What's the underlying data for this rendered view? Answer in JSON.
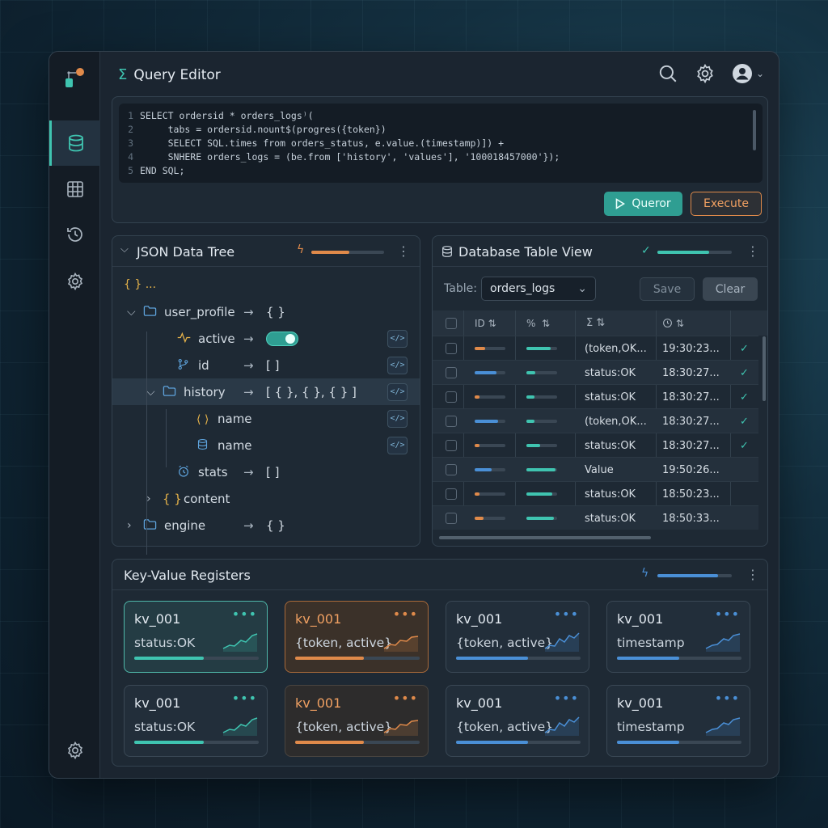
{
  "colors": {
    "accent_teal": "#3fc4b0",
    "accent_orange": "#e08a4a",
    "accent_blue": "#4a8fd6"
  },
  "sidebar": {
    "items": [
      {
        "icon": "database-icon",
        "active": true
      },
      {
        "icon": "table-grid-icon",
        "active": false
      },
      {
        "icon": "history-icon",
        "active": false
      },
      {
        "icon": "gear-icon",
        "active": false
      }
    ],
    "bottom_icon": "gear-icon"
  },
  "header": {
    "title": "Query Editor",
    "title_icon": "sigma-icon"
  },
  "editor": {
    "lines": [
      {
        "n": "1",
        "text": "SELECT ordersid * orders_logs⁾("
      },
      {
        "n": "2",
        "text": "     tabs = ordersid.nount$(progres({token})"
      },
      {
        "n": "3",
        "text": "     SELECT SQL.times from orders_status, e.value.(timestamp)]) +"
      },
      {
        "n": "4",
        "text": "     SNHERE orders_logs = (be.from ['history', 'values'], '100018457000'});"
      },
      {
        "n": "5",
        "text": "END SQL;"
      }
    ],
    "query_button": "Queror",
    "execute_button": "Execute"
  },
  "json_tree": {
    "title": "JSON Data Tree",
    "progress": 0.52,
    "root": "{ } ...",
    "rows": [
      {
        "label": "user_profile",
        "value": "{ }",
        "icon": "folder-icon"
      },
      {
        "label": "active",
        "value": "",
        "icon": "activity-icon",
        "toggle": true
      },
      {
        "label": "id",
        "value": "[ ]",
        "icon": "branch-icon"
      },
      {
        "label": "history",
        "value": "[ { }, { }, { } ]",
        "icon": "folder-icon"
      },
      {
        "label": "name",
        "value": "",
        "icon": "code-brackets-icon"
      },
      {
        "label": "name",
        "value": "",
        "icon": "database-icon"
      },
      {
        "label": "stats",
        "value": "[ ]",
        "icon": "clock-icon"
      },
      {
        "label": "content",
        "value": "",
        "icon": "braces-icon"
      },
      {
        "label": "engine",
        "value": "{ }",
        "icon": "folder-icon"
      }
    ],
    "arrow": "→",
    "chip": "</>"
  },
  "db_table": {
    "title": "Database Table View",
    "progress": 0.7,
    "table_label": "Table:",
    "table_selected": "orders_logs",
    "save_button": "Save",
    "clear_button": "Clear",
    "headers": [
      "ID",
      "%",
      "Σ",
      "clock"
    ],
    "rows": [
      {
        "p1": 0.35,
        "c1": "orange",
        "p2": 0.8,
        "text": "(token,OK...",
        "time": "19:30:23...",
        "check": "✓"
      },
      {
        "p1": 0.7,
        "c1": "blue",
        "p2": 0.3,
        "text": "status:OK",
        "time": "18:30:27...",
        "check": "✓"
      },
      {
        "p1": 0.15,
        "c1": "orange",
        "p2": 0.25,
        "text": "status:OK",
        "time": "18:30:27...",
        "check": "✓"
      },
      {
        "p1": 0.75,
        "c1": "blue",
        "p2": 0.25,
        "text": "(token,OK...",
        "time": "18:30:27...",
        "check": "✓"
      },
      {
        "p1": 0.15,
        "c1": "orange",
        "p2": 0.45,
        "text": "status:OK",
        "time": "18:30:27...",
        "check": "✓"
      },
      {
        "p1": 0.55,
        "c1": "blue",
        "p2": 0.95,
        "text": "Value",
        "time": "19:50:26...",
        "check": ""
      },
      {
        "p1": 0.15,
        "c1": "orange",
        "p2": 0.85,
        "text": "status:OK",
        "time": "18:50:23...",
        "check": ""
      },
      {
        "p1": 0.3,
        "c1": "orange",
        "p2": 0.9,
        "text": "status:OK",
        "time": "18:50:33...",
        "check": ""
      }
    ]
  },
  "kv": {
    "title": "Key-Value Registers",
    "progress": 0.82,
    "cards": [
      {
        "key": "kv_001",
        "value": "status:OK",
        "style": "teal",
        "color": "#3fc4b0",
        "fill": 0.56
      },
      {
        "key": "kv_001",
        "value": "{token, active}",
        "style": "orange",
        "color": "#e08a4a",
        "fill": 0.55
      },
      {
        "key": "kv_001",
        "value": "{token, active}",
        "style": "plain",
        "color": "#4a8fd6",
        "fill": 0.58
      },
      {
        "key": "kv_001",
        "value": "timestamp",
        "style": "plain",
        "color": "#4a8fd6",
        "fill": 0.5
      },
      {
        "key": "kv_001",
        "value": "status:OK",
        "style": "plain",
        "color": "#3fc4b0",
        "fill": 0.56
      },
      {
        "key": "kv_001",
        "value": "{token, active}",
        "style": "orange2",
        "color": "#e08a4a",
        "fill": 0.55
      },
      {
        "key": "kv_001",
        "value": "{token, active}",
        "style": "plain",
        "color": "#4a8fd6",
        "fill": 0.58
      },
      {
        "key": "kv_001",
        "value": "timestamp",
        "style": "plain",
        "color": "#4a8fd6",
        "fill": 0.5
      }
    ],
    "dots": "•••"
  }
}
